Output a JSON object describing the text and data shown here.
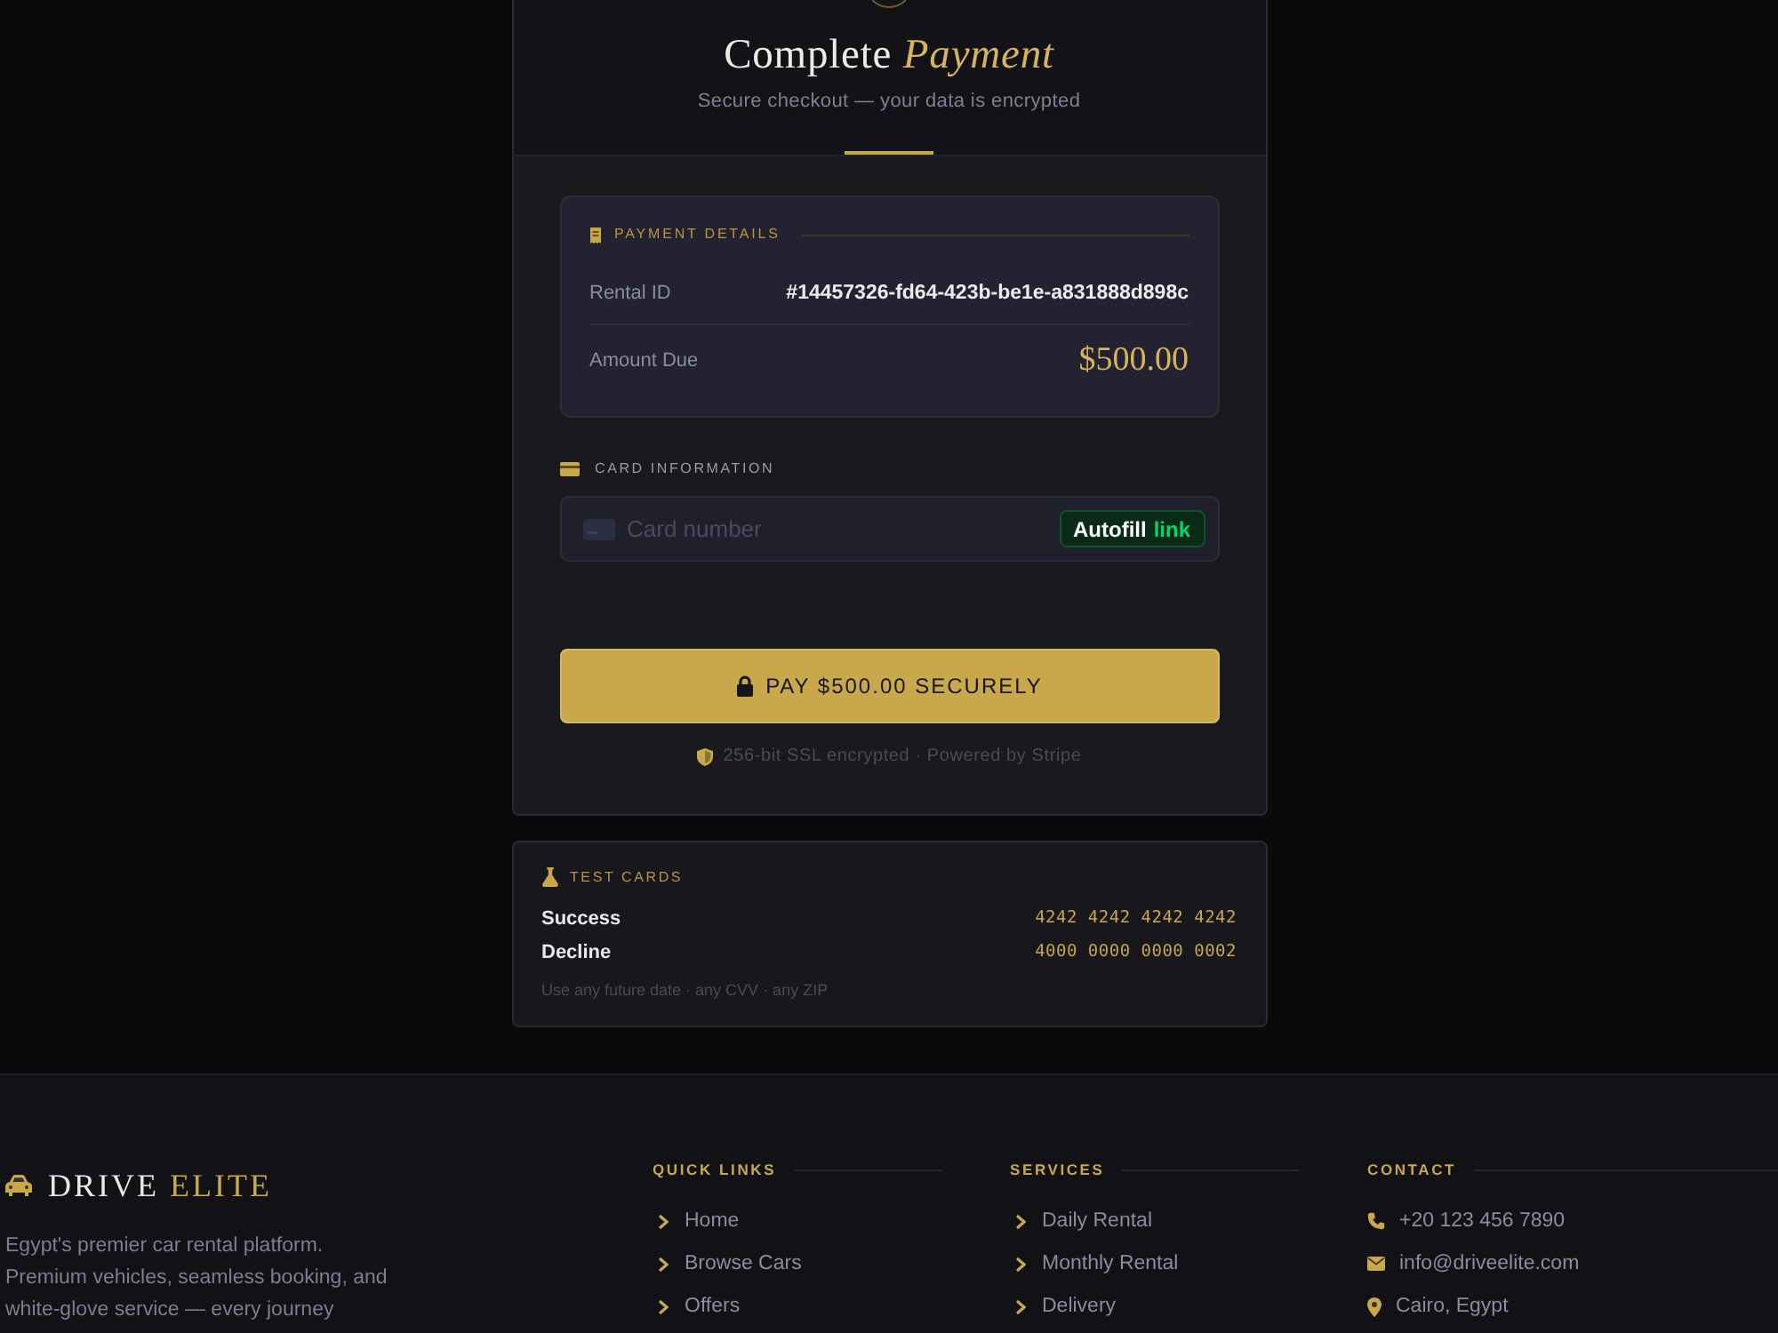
{
  "header": {
    "title": "Complete",
    "title_accent": "Payment",
    "subtitle": "Secure checkout — your data is encrypted"
  },
  "payment_details": {
    "heading": "PAYMENT DETAILS",
    "rows": [
      {
        "kind": "id",
        "label": "Rental ID",
        "value": "#14457326-fd64-423b-be1e-a831888d898c"
      },
      {
        "kind": "amount",
        "label": "Amount Due",
        "value": "$500.00"
      }
    ]
  },
  "card_information": {
    "heading": "CARD INFORMATION",
    "card_field": {
      "placeholder": "Card number"
    },
    "autofill_button": {
      "label": "Autofill",
      "brand": "link"
    }
  },
  "pay_button": {
    "label": "PAY $500.00 SECURELY"
  },
  "security_note": "256-bit SSL encrypted · Powered by Stripe",
  "test_cards": {
    "heading": "TEST CARDS",
    "rows": [
      {
        "label": "Success",
        "number": "4242 4242 4242 4242"
      },
      {
        "label": "Decline",
        "number": "4000 0000 0000 0002"
      }
    ],
    "note": "Use any future date · any CVV · any ZIP"
  },
  "footer": {
    "brand": {
      "name": "DRIVE",
      "accent": "ELITE"
    },
    "description_lines": [
      "Egypt's premier car rental platform.",
      "Premium vehicles, seamless booking, and",
      "white-glove service — every journey"
    ],
    "columns": [
      {
        "kind": "links",
        "heading": "QUICK LINKS",
        "items": [
          {
            "text": "Home"
          },
          {
            "text": "Browse Cars"
          },
          {
            "text": "Offers"
          }
        ]
      },
      {
        "kind": "links",
        "heading": "SERVICES",
        "items": [
          {
            "text": "Daily Rental"
          },
          {
            "text": "Monthly Rental"
          },
          {
            "text": "Delivery"
          }
        ]
      },
      {
        "kind": "contact",
        "heading": "CONTACT",
        "items": [
          {
            "kind": "phone",
            "text": "+20 123 456 7890"
          },
          {
            "kind": "email",
            "text": "info@driveelite.com"
          },
          {
            "kind": "address",
            "text": "Cairo, Egypt"
          }
        ]
      }
    ]
  }
}
